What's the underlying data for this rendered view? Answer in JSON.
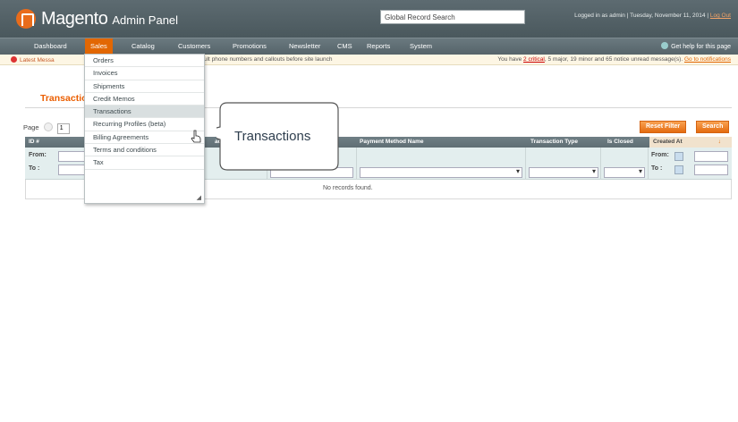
{
  "header": {
    "logo_word": "Magento",
    "logo_sub": "Admin Panel",
    "search_value": "Global Record Search",
    "user_text": "Logged in as admin",
    "separator": "|",
    "date_text": "Tuesday, November 11, 2014",
    "logout_label": "Log Out"
  },
  "nav": {
    "items": [
      "Dashboard",
      "Sales",
      "Catalog",
      "Customers",
      "Promotions",
      "Newsletter",
      "CMS",
      "Reports",
      "System"
    ],
    "help_label": "Get help for this page"
  },
  "messages": {
    "left": "Latest Messa",
    "middle": "ult phone numbers and callouts before site launch",
    "right_pre": "You have ",
    "right_critical": "2 critical",
    "right_post": ", 5 major, 19 minor and 65 notice unread message(s). ",
    "right_link": "Go to notifications"
  },
  "page": {
    "title": "Transactio"
  },
  "pager": {
    "label": "Page",
    "page_value": "1"
  },
  "buttons": {
    "reset_filter": "Reset Filter",
    "search": "Search"
  },
  "grid": {
    "headers": [
      "ID #",
      "acti",
      "",
      "Payment Method Name",
      "Transaction Type",
      "Is Closed",
      "Created At"
    ],
    "sort_arrow": "↓",
    "from_label": "From:",
    "to_label": "To :",
    "empty_text": "No records found."
  },
  "sales_menu": {
    "items": [
      "Orders",
      "Invoices",
      "Shipments",
      "Credit Memos",
      "Transactions",
      "Recurring Profiles (beta)",
      "Billing Agreements",
      "Terms and conditions",
      "Tax"
    ],
    "hovered": "Transactions"
  },
  "callout": {
    "text": "Transactions"
  },
  "colors": {
    "accent": "#e26703",
    "header_bg": "#56646a",
    "title": "#eb5e00"
  }
}
